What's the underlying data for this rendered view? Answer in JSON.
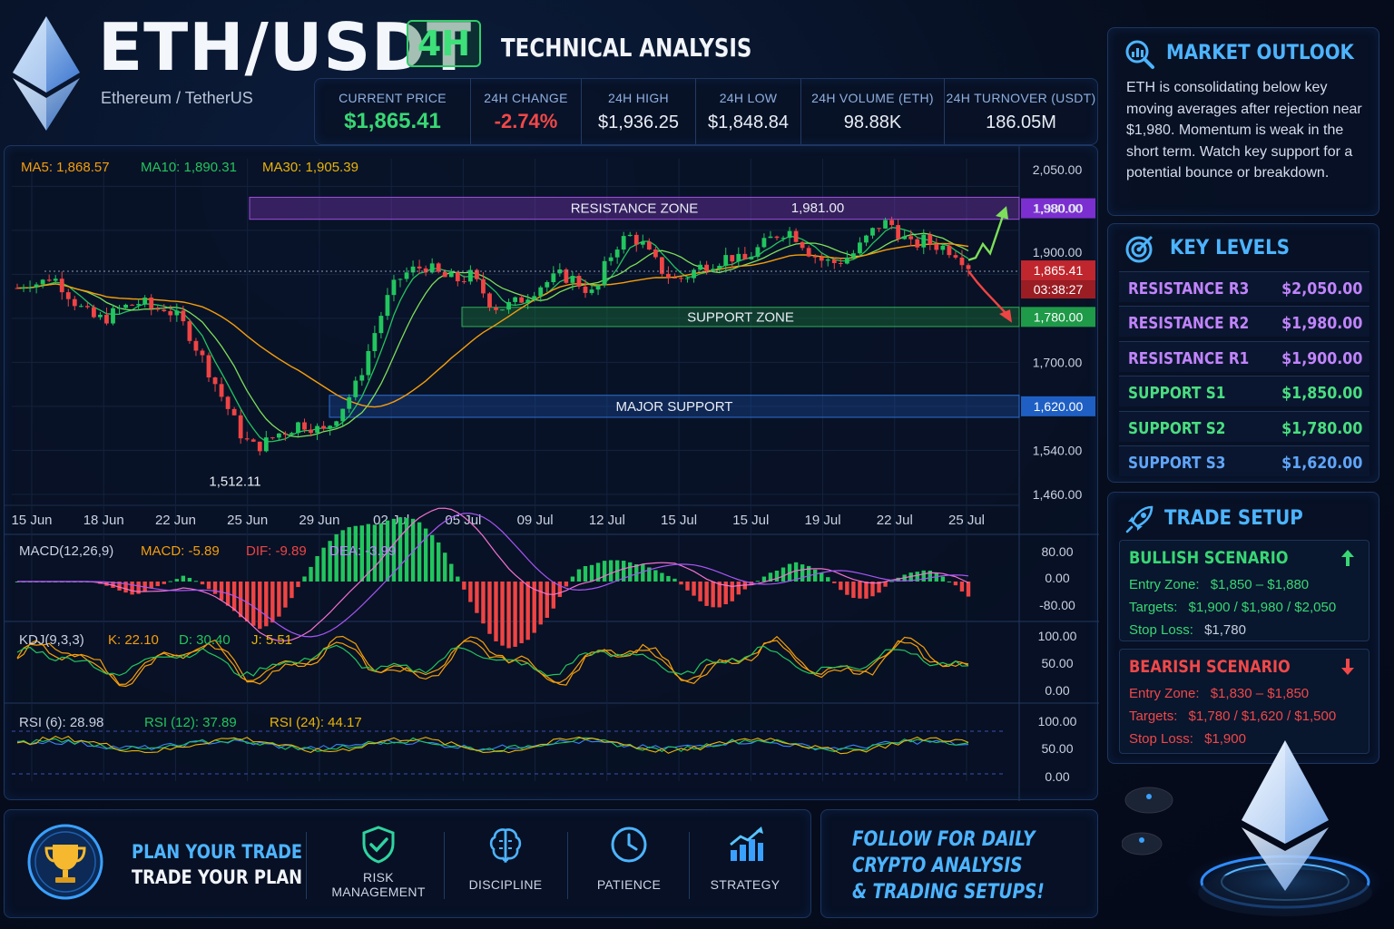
{
  "header": {
    "title": "ETH/USDT",
    "subtitle": "Ethereum / TetherUS",
    "timeframe": "4H",
    "section": "TECHNICAL ANALYSIS"
  },
  "stats": [
    {
      "label": "CURRENT PRICE",
      "value": "$1,865.41",
      "tone": "green"
    },
    {
      "label": "24H CHANGE",
      "value": "-2.74%",
      "tone": "red"
    },
    {
      "label": "24H HIGH",
      "value": "$1,936.25",
      "tone": "plain"
    },
    {
      "label": "24H LOW",
      "value": "$1,848.84",
      "tone": "plain"
    },
    {
      "label": "24H VOLUME (ETH)",
      "value": "98.88K",
      "tone": "plain"
    },
    {
      "label": "24H TURNOVER (USDT)",
      "value": "186.05M",
      "tone": "plain"
    }
  ],
  "outlook": {
    "heading": "MARKET OUTLOOK",
    "text": "ETH is consolidating below key moving averages after rejection near $1,980. Momentum is weak in the short term. Watch key support for a potential bounce or breakdown."
  },
  "key_levels": {
    "heading": "KEY LEVELS",
    "rows": [
      {
        "name": "RESISTANCE R3",
        "value": "$2,050.00",
        "kind": "resistance"
      },
      {
        "name": "RESISTANCE R2",
        "value": "$1,980.00",
        "kind": "resistance"
      },
      {
        "name": "RESISTANCE R1",
        "value": "$1,900.00",
        "kind": "resistance"
      },
      {
        "name": "SUPPORT S1",
        "value": "$1,850.00",
        "kind": "support"
      },
      {
        "name": "SUPPORT S2",
        "value": "$1,780.00",
        "kind": "support"
      },
      {
        "name": "SUPPORT S3",
        "value": "$1,620.00",
        "kind": "major"
      }
    ]
  },
  "trade_setup": {
    "heading": "TRADE SETUP",
    "bullish": {
      "title": "BULLISH SCENARIO",
      "entry_label": "Entry Zone:",
      "entry": "$1,850 – $1,880",
      "targets_label": "Targets:",
      "targets": "$1,900 / $1,980 / $2,050",
      "stop_label": "Stop Loss:",
      "stop": "$1,780"
    },
    "bearish": {
      "title": "BEARISH SCENARIO",
      "entry_label": "Entry Zone:",
      "entry": "$1,830 – $1,850",
      "targets_label": "Targets:",
      "targets": "$1,780 / $1,620 / $1,500",
      "stop_label": "Stop Loss:",
      "stop": "$1,900"
    }
  },
  "footer": {
    "plan_line1": "PLAN YOUR TRADE",
    "plan_line2": "TRADE YOUR PLAN",
    "pillars": [
      {
        "label": "RISK\nMANAGEMENT",
        "icon": "shield-check-icon"
      },
      {
        "label": "DISCIPLINE",
        "icon": "brain-icon"
      },
      {
        "label": "PATIENCE",
        "icon": "clock-icon"
      },
      {
        "label": "STRATEGY",
        "icon": "bar-chart-icon"
      }
    ],
    "follow_lines": [
      "FOLLOW FOR DAILY",
      "CRYPTO ANALYSIS",
      "& TRADING SETUPS!"
    ]
  },
  "colors": {
    "up": "#22c55e",
    "down": "#ef4444",
    "ma5": "#f59e0b",
    "ma10": "#22c55e",
    "ma30": "#eab308",
    "resistance": "#a855f7",
    "support": "#22c55e",
    "major": "#3b82f6",
    "accent": "#4db4ff"
  },
  "chart_data": {
    "type": "candlestick",
    "x_ticks": [
      "15 Jun",
      "18 Jun",
      "22 Jun",
      "25 Jun",
      "29 Jun",
      "02 Jul",
      "05 Jul",
      "09 Jul",
      "12 Jul",
      "15 Jul",
      "15 Jul",
      "19 Jul",
      "22 Jul",
      "25 Jul"
    ],
    "price_axis": {
      "ticks": [
        "2,050.00",
        "1,980.00",
        "1,900.00",
        "1,700.00",
        "1,540.00",
        "1,460.00"
      ],
      "ylim": [
        1440,
        2070
      ]
    },
    "ma_legend": [
      {
        "label": "MA5: 1,868.57",
        "color": "#f59e0b"
      },
      {
        "label": "MA10: 1,890.31",
        "color": "#22c55e"
      },
      {
        "label": "MA30: 1,905.39",
        "color": "#eab308"
      }
    ],
    "zones": [
      {
        "label": "RESISTANCE ZONE",
        "low": 1960,
        "high": 2000,
        "kind": "resistance",
        "axis_label": "1,980.00"
      },
      {
        "label": "SUPPORT ZONE",
        "low": 1765,
        "high": 1800,
        "kind": "support",
        "axis_label": "1,780.00"
      },
      {
        "label": "MAJOR SUPPORT",
        "low": 1600,
        "high": 1640,
        "kind": "major",
        "axis_label": "1,620.00"
      }
    ],
    "current_price": {
      "value": 1865.41,
      "label": "1,865.41",
      "countdown": "03:38:27"
    },
    "annotations": [
      {
        "text": "1,981.00",
        "value": 1981
      },
      {
        "text": "1,512.11",
        "value": 1512.11
      }
    ],
    "price_path": [
      1835,
      1848,
      1842,
      1858,
      1838,
      1812,
      1790,
      1778,
      1782,
      1796,
      1804,
      1810,
      1795,
      1800,
      1784,
      1760,
      1720,
      1682,
      1640,
      1600,
      1560,
      1545,
      1555,
      1570,
      1578,
      1590,
      1584,
      1572,
      1598,
      1628,
      1660,
      1720,
      1780,
      1830,
      1858,
      1868,
      1876,
      1862,
      1852,
      1850,
      1858,
      1832,
      1802,
      1800,
      1808,
      1822,
      1838,
      1848,
      1858,
      1852,
      1838,
      1820,
      1880,
      1915,
      1930,
      1920,
      1890,
      1866,
      1850,
      1855,
      1870,
      1880,
      1886,
      1894,
      1880,
      1900,
      1915,
      1932,
      1941,
      1926,
      1900,
      1886,
      1880,
      1888,
      1900,
      1925,
      1948,
      1955,
      1932,
      1910,
      1922,
      1914,
      1908,
      1900,
      1876
    ],
    "macd": {
      "title": "MACD(12,26,9)",
      "values": {
        "macd": "MACD: -5.89",
        "dif": "DIF: -9.89",
        "dea": "DEA: -3.99"
      },
      "ticks": [
        "80.00",
        "0.00",
        "-80.00"
      ],
      "ylim": [
        -100,
        100
      ]
    },
    "kdj": {
      "title": "KDJ(9,3,3)",
      "values": {
        "k": "K: 22.10",
        "d": "D: 30.40",
        "j": "J: 5.51"
      },
      "ticks": [
        "100.00",
        "50.00",
        "0.00"
      ],
      "ylim": [
        -10,
        110
      ]
    },
    "rsi": {
      "title": "RSI (6): 28.98",
      "rsi12": "RSI (12): 37.89",
      "rsi24": "RSI (24): 44.17",
      "ticks": [
        "100.00",
        "50.00",
        "0.00"
      ],
      "ylim": [
        -10,
        110
      ]
    }
  }
}
